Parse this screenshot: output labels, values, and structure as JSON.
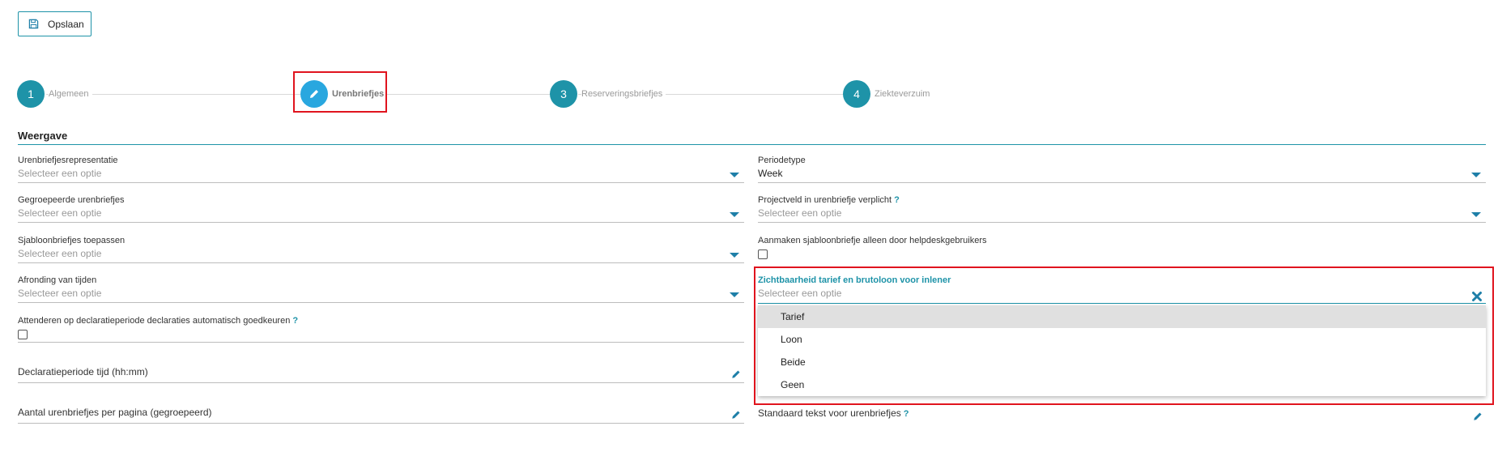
{
  "toolbar": {
    "save_label": "Opslaan"
  },
  "stepper": {
    "steps": [
      {
        "number": "1",
        "label": "Algemeen"
      },
      {
        "number": "",
        "label": "Urenbriefjes"
      },
      {
        "number": "3",
        "label": "Reserveringsbriefjes"
      },
      {
        "number": "4",
        "label": "Ziekteverzuim"
      }
    ]
  },
  "section": {
    "title": "Weergave"
  },
  "left": {
    "representatie": {
      "label": "Urenbriefjesrepresentatie",
      "value": "Selecteer een optie"
    },
    "gegroepeerd": {
      "label": "Gegroepeerde urenbriefjes",
      "value": "Selecteer een optie"
    },
    "sjabloon": {
      "label": "Sjabloonbriefjes toepassen",
      "value": "Selecteer een optie"
    },
    "afronding": {
      "label": "Afronding van tijden",
      "value": "Selecteer een optie"
    },
    "attenderen": {
      "label": "Attenderen op declaratieperiode declaraties automatisch goedkeuren",
      "help": "?"
    },
    "declaratietijd": {
      "label": "Declaratieperiode tijd (hh:mm)"
    },
    "aantal": {
      "label": "Aantal urenbriefjes per pagina (gegroepeerd)"
    }
  },
  "right": {
    "periodetype": {
      "label": "Periodetype",
      "value": "Week"
    },
    "projectveld": {
      "label": "Projectveld in urenbriefje verplicht",
      "help": "?",
      "value": "Selecteer een optie"
    },
    "aanmaken": {
      "label": "Aanmaken sjabloonbriefje alleen door helpdeskgebruikers"
    },
    "zichtbaarheid": {
      "label": "Zichtbaarheid tarief en brutoloon voor inlener",
      "placeholder": "Selecteer een optie",
      "options": [
        "Tarief",
        "Loon",
        "Beide",
        "Geen"
      ]
    },
    "standaardtekst": {
      "label": "Standaard tekst voor urenbriefjes",
      "help": "?"
    }
  },
  "colors": {
    "accent": "#1e93a8",
    "active_step": "#29a7df",
    "highlight": "#e0141e"
  },
  "icons": [
    "save-icon",
    "pencil-icon",
    "chevron-down-icon",
    "close-icon"
  ]
}
